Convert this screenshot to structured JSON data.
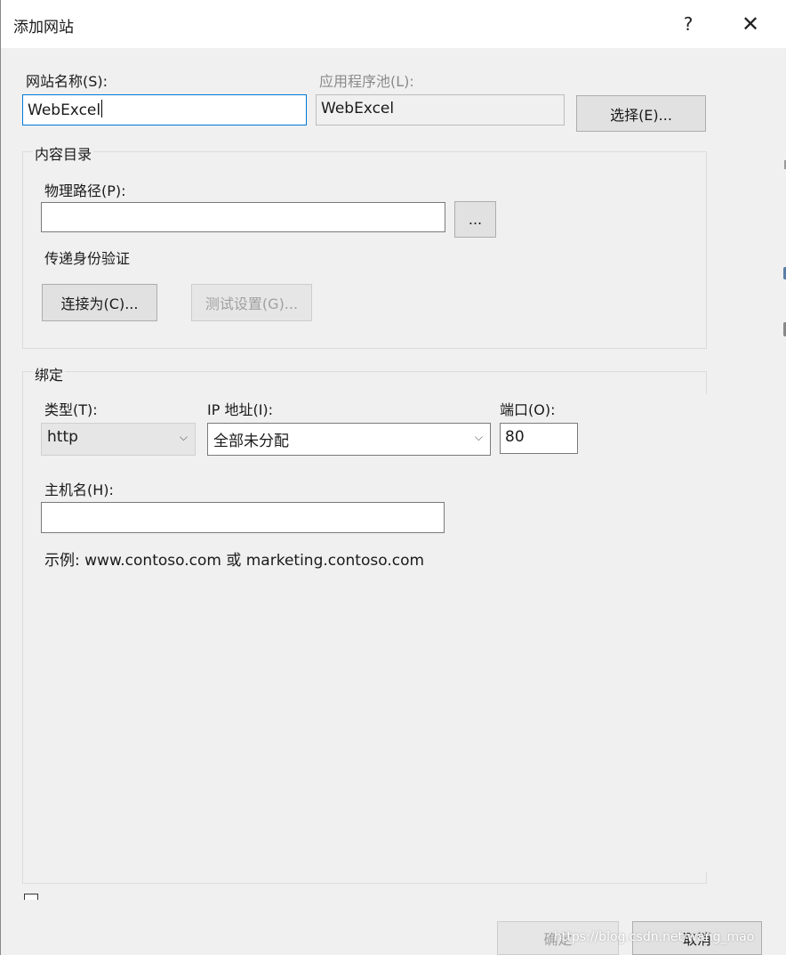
{
  "window": {
    "title": "添加网站",
    "help_glyph": "?",
    "close_glyph": "✕"
  },
  "site_name": {
    "label": "网站名称(S):",
    "value": "WebExcel"
  },
  "app_pool": {
    "label": "应用程序池(L):",
    "value": "WebExcel",
    "select_button": "选择(E)..."
  },
  "content_dir": {
    "group_label": "内容目录",
    "physical_path_label": "物理路径(P):",
    "physical_path_value": "",
    "browse_button": "...",
    "pass_auth_label": "传递身份验证",
    "connect_as_button": "连接为(C)...",
    "test_settings_button": "测试设置(G)..."
  },
  "binding": {
    "group_label": "绑定",
    "type_label": "类型(T):",
    "type_value": "http",
    "ip_label": "IP 地址(I):",
    "ip_value": "全部未分配",
    "port_label": "端口(O):",
    "port_value": "80",
    "host_label": "主机名(H):",
    "host_value": "",
    "example_text": "示例: www.contoso.com 或 marketing.contoso.com"
  },
  "footer": {
    "ok_button": "确定",
    "cancel_button": "取消",
    "watermark": "https://blog.csdn.net/wang_mao"
  },
  "icons": {
    "chevron": "⌵"
  }
}
